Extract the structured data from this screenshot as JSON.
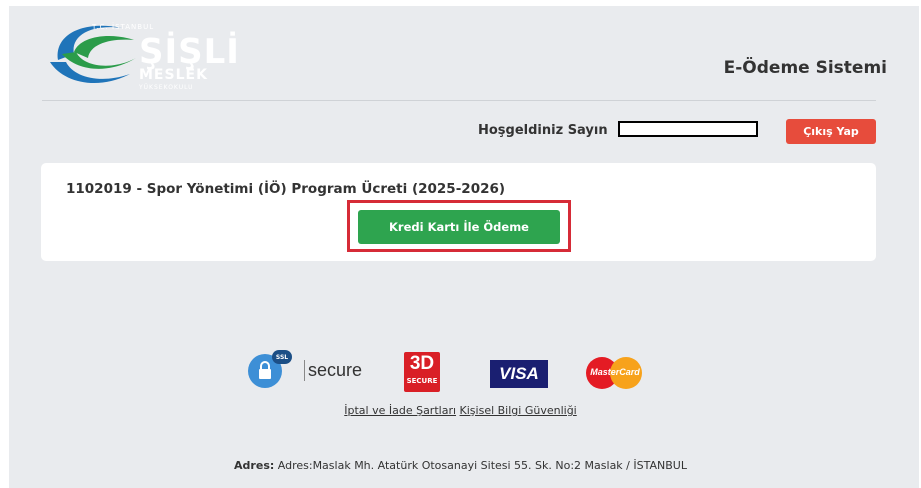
{
  "header": {
    "logo": {
      "tc": "T.C. İSTANBUL",
      "name": "ŞİŞLİ",
      "line2": "MESLEK",
      "line3": "YÜKSEKOKULU"
    },
    "system_title": "E-Ödeme Sistemi"
  },
  "user_bar": {
    "welcome": "Hoşgeldiniz Sayın",
    "logout_label": "Çıkış Yap"
  },
  "payment": {
    "title": "1102019 - Spor Yönetimi (İÖ) Program Ücreti (2025-2026)",
    "pay_button_label": "Kredi Kartı İle Ödeme"
  },
  "badges": {
    "ssl_tag": "SSL",
    "secure": "secure",
    "three_d_top": "3D",
    "three_d_bottom": "SECURE",
    "visa": "VISA",
    "mastercard": "MasterCard"
  },
  "footer": {
    "link1": "İptal ve İade Şartları",
    "link2": "Kişisel Bilgi Güvenliği",
    "address_label": "Adres:",
    "address_text": "Adres:Maslak Mh. Atatürk Otosanayi Sitesi 55. Sk. No:2 Maslak / İSTANBUL"
  },
  "colors": {
    "background": "#e9ebee",
    "logout": "#e74c3c",
    "pay_button": "#2ea44f",
    "highlight": "#d62b37"
  }
}
